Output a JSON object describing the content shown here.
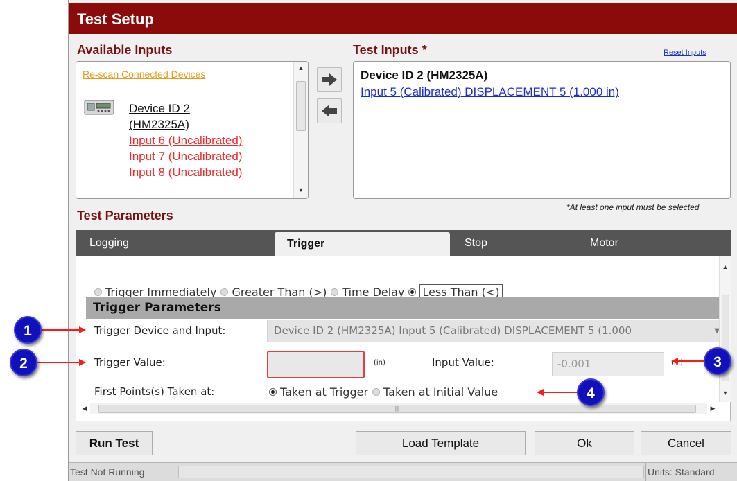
{
  "window": {
    "title": "Test Setup"
  },
  "available_inputs": {
    "title": "Available Inputs",
    "rescan_label": "Re-scan Connected Devices",
    "device_name_line1": "Device ID 2",
    "device_name_line2": "(HM2325A)",
    "inputs": [
      "Input 6 (Uncalibrated)",
      "Input 7 (Uncalibrated)",
      "Input 8 (Uncalibrated)"
    ]
  },
  "test_inputs": {
    "title": "Test Inputs",
    "required_marker": "*",
    "reset_label": "Reset Inputs",
    "device_name": "Device ID 2 (HM2325A)",
    "selected_input": "Input 5 (Calibrated) DISPLACEMENT 5 (1.000 in)",
    "note": "*At least one input must be selected"
  },
  "test_parameters": {
    "title": "Test Parameters",
    "tabs": [
      {
        "label": "Logging",
        "active": false
      },
      {
        "label": "Trigger",
        "active": true
      },
      {
        "label": "Stop",
        "active": false
      },
      {
        "label": "Motor",
        "active": false
      }
    ]
  },
  "trigger": {
    "modes": [
      {
        "label": "Trigger Immediately",
        "selected": false
      },
      {
        "label": "Greater Than (>)",
        "selected": false
      },
      {
        "label": "Time Delay",
        "selected": false
      },
      {
        "label": "Less Than (<)",
        "selected": true
      }
    ],
    "params_header": "Trigger Parameters",
    "device_input_label": "Trigger Device and Input:",
    "device_input_value": "Device ID 2 (HM2325A) Input 5 (Calibrated) DISPLACEMENT 5 (1.000",
    "trigger_value_label": "Trigger Value:",
    "trigger_value": "",
    "trigger_unit": "(in)",
    "input_value_label": "Input Value:",
    "input_value": "-0.001",
    "input_unit": "(in)",
    "first_points_label": "First Points(s) Taken at:",
    "first_points_options": [
      {
        "label": "Taken at Trigger",
        "selected": true
      },
      {
        "label": "Taken at Initial Value",
        "selected": false
      }
    ]
  },
  "buttons": {
    "run_test": "Run Test",
    "load_template": "Load Template",
    "ok": "Ok",
    "cancel": "Cancel"
  },
  "status": {
    "left": "Test Not Running",
    "right": "Units: Standard"
  },
  "callouts": [
    "1",
    "2",
    "3",
    "4"
  ],
  "colors": {
    "title_bar": "#8b0a0a",
    "section_title": "#7a1010",
    "callout": "#1111bb",
    "callout_arrow": "#ff0000",
    "uncalibrated_link": "#ee2b2b",
    "calibrated_link": "#1a2fc9",
    "rescan_link": "#e89a1a"
  }
}
